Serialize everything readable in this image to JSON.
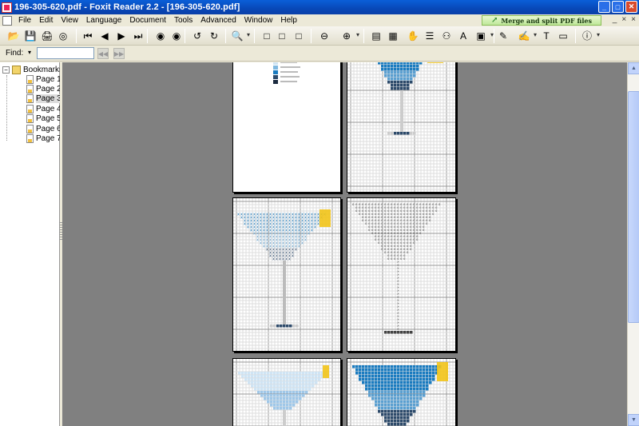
{
  "window": {
    "title": "196-305-620.pdf - Foxit Reader 2.2 - [196-305-620.pdf]",
    "min_glyph": "_",
    "max_glyph": "□",
    "close_glyph": "✕"
  },
  "menu": {
    "items": [
      "File",
      "Edit",
      "View",
      "Language",
      "Document",
      "Tools",
      "Advanced",
      "Window",
      "Help"
    ],
    "promo": "Merge and split PDF files",
    "mdi_min": "_",
    "mdi_restore": "×",
    "mdi_close": "×"
  },
  "toolbar": {
    "buttons": [
      {
        "name": "open-icon",
        "glyph": "📂"
      },
      {
        "name": "save-icon",
        "glyph": "💾"
      },
      {
        "name": "print-icon",
        "glyph": "🖨"
      },
      {
        "name": "email-icon",
        "glyph": "◎"
      },
      {
        "name": "first-page-icon",
        "glyph": "⏮"
      },
      {
        "name": "previous-page-icon",
        "glyph": "◀"
      },
      {
        "name": "next-page-icon",
        "glyph": "▶"
      },
      {
        "name": "last-page-icon",
        "glyph": "⏭"
      },
      {
        "name": "go-back-icon",
        "glyph": "◉"
      },
      {
        "name": "go-forward-icon",
        "glyph": "◉"
      },
      {
        "name": "rotate-left-icon",
        "glyph": "↺"
      },
      {
        "name": "rotate-right-icon",
        "glyph": "↻"
      },
      {
        "name": "zoom-icon",
        "glyph": "🔍"
      },
      {
        "name": "actual-size-icon",
        "glyph": "□"
      },
      {
        "name": "fit-page-icon",
        "glyph": "□"
      },
      {
        "name": "fit-width-icon",
        "glyph": "□"
      },
      {
        "name": "zoom-out-icon",
        "glyph": "⊖"
      },
      {
        "name": "zoom-in-icon",
        "glyph": "⊕"
      },
      {
        "name": "bookmark-panel-icon",
        "glyph": "▤"
      },
      {
        "name": "thumbnail-icon",
        "glyph": "▦"
      },
      {
        "name": "hand-tool-icon",
        "glyph": "✋"
      },
      {
        "name": "select-text-icon",
        "glyph": "☰"
      },
      {
        "name": "find-icon",
        "glyph": "⚇"
      },
      {
        "name": "typewriter-icon",
        "glyph": "A"
      },
      {
        "name": "snapshot-icon",
        "glyph": "▣"
      },
      {
        "name": "pencil-icon",
        "glyph": "✎"
      },
      {
        "name": "highlight-icon",
        "glyph": "✍"
      },
      {
        "name": "text-tool-icon",
        "glyph": "T"
      },
      {
        "name": "note-icon",
        "glyph": "▭"
      },
      {
        "name": "info-icon",
        "glyph": "ⓘ"
      }
    ]
  },
  "find": {
    "label": "Find:",
    "dropdown_glyph": "▾",
    "value": "",
    "prev_glyph": "◀◀",
    "next_glyph": "▶▶"
  },
  "bookmarks": {
    "root_label": "Bookmarks",
    "expander": "−",
    "pages": [
      "Page 1",
      "Page 2",
      "Page 3",
      "Page 4",
      "Page 5",
      "Page 6",
      "Page 7"
    ],
    "selected_index": 2
  },
  "colors": {
    "viewer_bg": "#808080",
    "pattern_blue": "#1a7bbf",
    "pattern_dark": "#2d4a6a",
    "pattern_light": "#cfe4f4",
    "lemon": "#f2c418"
  },
  "scrollbar": {
    "up_glyph": "▲",
    "down_glyph": "▼"
  }
}
